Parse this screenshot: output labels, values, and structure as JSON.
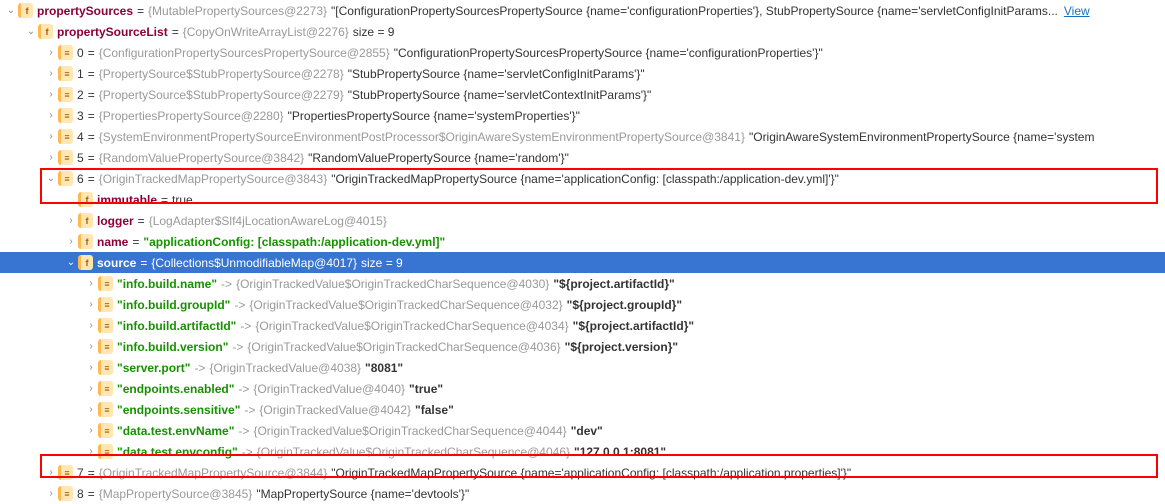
{
  "root": {
    "name": "propertySources",
    "hash": "{MutablePropertySources@2273}",
    "value": "\"[ConfigurationPropertySourcesPropertySource {name='configurationProperties'}, StubPropertySource {name='servletConfigInitParams...",
    "view": "View"
  },
  "psl": {
    "name": "propertySourceList",
    "hash": "{CopyOnWriteArrayList@2276}",
    "size": "size = 9"
  },
  "items": [
    {
      "idx": "0",
      "hash": "{ConfigurationPropertySourcesPropertySource@2855}",
      "val": "\"ConfigurationPropertySourcesPropertySource {name='configurationProperties'}\""
    },
    {
      "idx": "1",
      "hash": "{PropertySource$StubPropertySource@2278}",
      "val": "\"StubPropertySource {name='servletConfigInitParams'}\""
    },
    {
      "idx": "2",
      "hash": "{PropertySource$StubPropertySource@2279}",
      "val": "\"StubPropertySource {name='servletContextInitParams'}\""
    },
    {
      "idx": "3",
      "hash": "{PropertiesPropertySource@2280}",
      "val": "\"PropertiesPropertySource {name='systemProperties'}\""
    },
    {
      "idx": "4",
      "hash": "{SystemEnvironmentPropertySourceEnvironmentPostProcessor$OriginAwareSystemEnvironmentPropertySource@3841}",
      "val": "\"OriginAwareSystemEnvironmentPropertySource {name='system"
    },
    {
      "idx": "5",
      "hash": "{RandomValuePropertySource@3842}",
      "val": "\"RandomValuePropertySource {name='random'}\""
    }
  ],
  "item6": {
    "idx": "6",
    "hash": "{OriginTrackedMapPropertySource@3843}",
    "val": "\"OriginTrackedMapPropertySource {name='applicationConfig: [classpath:/application-dev.yml]'}\""
  },
  "immutable": {
    "name": "immutable",
    "val": "true"
  },
  "logger": {
    "name": "logger",
    "hash": "{LogAdapter$Slf4jLocationAwareLog@4015}"
  },
  "nameProp": {
    "name": "name",
    "val": "\"applicationConfig: [classpath:/application-dev.yml]\""
  },
  "source": {
    "name": "source",
    "hash": "{Collections$UnmodifiableMap@4017}",
    "size": "size = 9"
  },
  "entries": [
    {
      "key": "\"info.build.name\"",
      "hash": "{OriginTrackedValue$OriginTrackedCharSequence@4030}",
      "v": "\"${project.artifactId}\""
    },
    {
      "key": "\"info.build.groupId\"",
      "hash": "{OriginTrackedValue$OriginTrackedCharSequence@4032}",
      "v": "\"${project.groupId}\""
    },
    {
      "key": "\"info.build.artifactId\"",
      "hash": "{OriginTrackedValue$OriginTrackedCharSequence@4034}",
      "v": "\"${project.artifactId}\""
    },
    {
      "key": "\"info.build.version\"",
      "hash": "{OriginTrackedValue$OriginTrackedCharSequence@4036}",
      "v": "\"${project.version}\""
    },
    {
      "key": "\"server.port\"",
      "hash": "{OriginTrackedValue@4038}",
      "v": "\"8081\""
    },
    {
      "key": "\"endpoints.enabled\"",
      "hash": "{OriginTrackedValue@4040}",
      "v": "\"true\""
    },
    {
      "key": "\"endpoints.sensitive\"",
      "hash": "{OriginTrackedValue@4042}",
      "v": "\"false\""
    },
    {
      "key": "\"data.test.envName\"",
      "hash": "{OriginTrackedValue$OriginTrackedCharSequence@4044}",
      "v": "\"dev\""
    },
    {
      "key": "\"data.test.envconfig\"",
      "hash": "{OriginTrackedValue$OriginTrackedCharSequence@4046}",
      "v": "\"127.0.0.1:8081\""
    }
  ],
  "item7": {
    "idx": "7",
    "hash": "{OriginTrackedMapPropertySource@3844}",
    "val": "\"OriginTrackedMapPropertySource {name='applicationConfig: [classpath:/application.properties]'}\""
  },
  "item8": {
    "idx": "8",
    "hash": "{MapPropertySource@3845}",
    "val": "\"MapPropertySource {name='devtools'}\""
  },
  "icons": {
    "f": "f",
    "arr": "≡",
    "p": "p"
  }
}
